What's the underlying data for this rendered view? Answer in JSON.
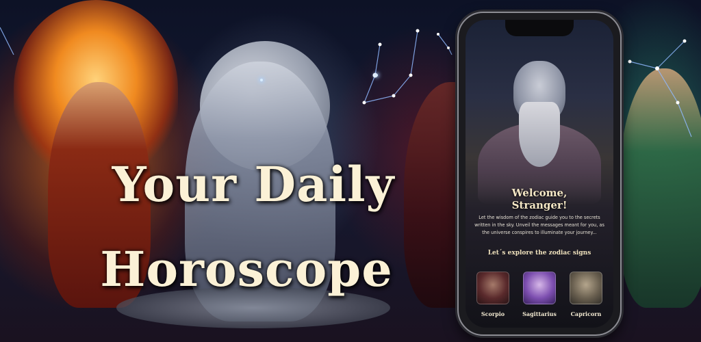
{
  "banner": {
    "headline_line1": "Your Daily",
    "headline_line2": "Horoscope"
  },
  "phone_app": {
    "welcome_line1": "Welcome,",
    "welcome_line2": "Stranger!",
    "intro_text": "Let the wisdom of the zodiac guide you to the secrets written in the sky. Unveil the messages meant for you, as the universe conspires to illuminate your journey...",
    "explore_heading": "Let´s explore the zodiac signs",
    "zodiac_signs": [
      {
        "label": "Scorpio"
      },
      {
        "label": "Sagittarius"
      },
      {
        "label": "Capricorn"
      }
    ]
  },
  "colors": {
    "headline": "#fbf1d6",
    "accent_gold": "#f3e6c4",
    "phone_frame": "#8c8c93"
  }
}
